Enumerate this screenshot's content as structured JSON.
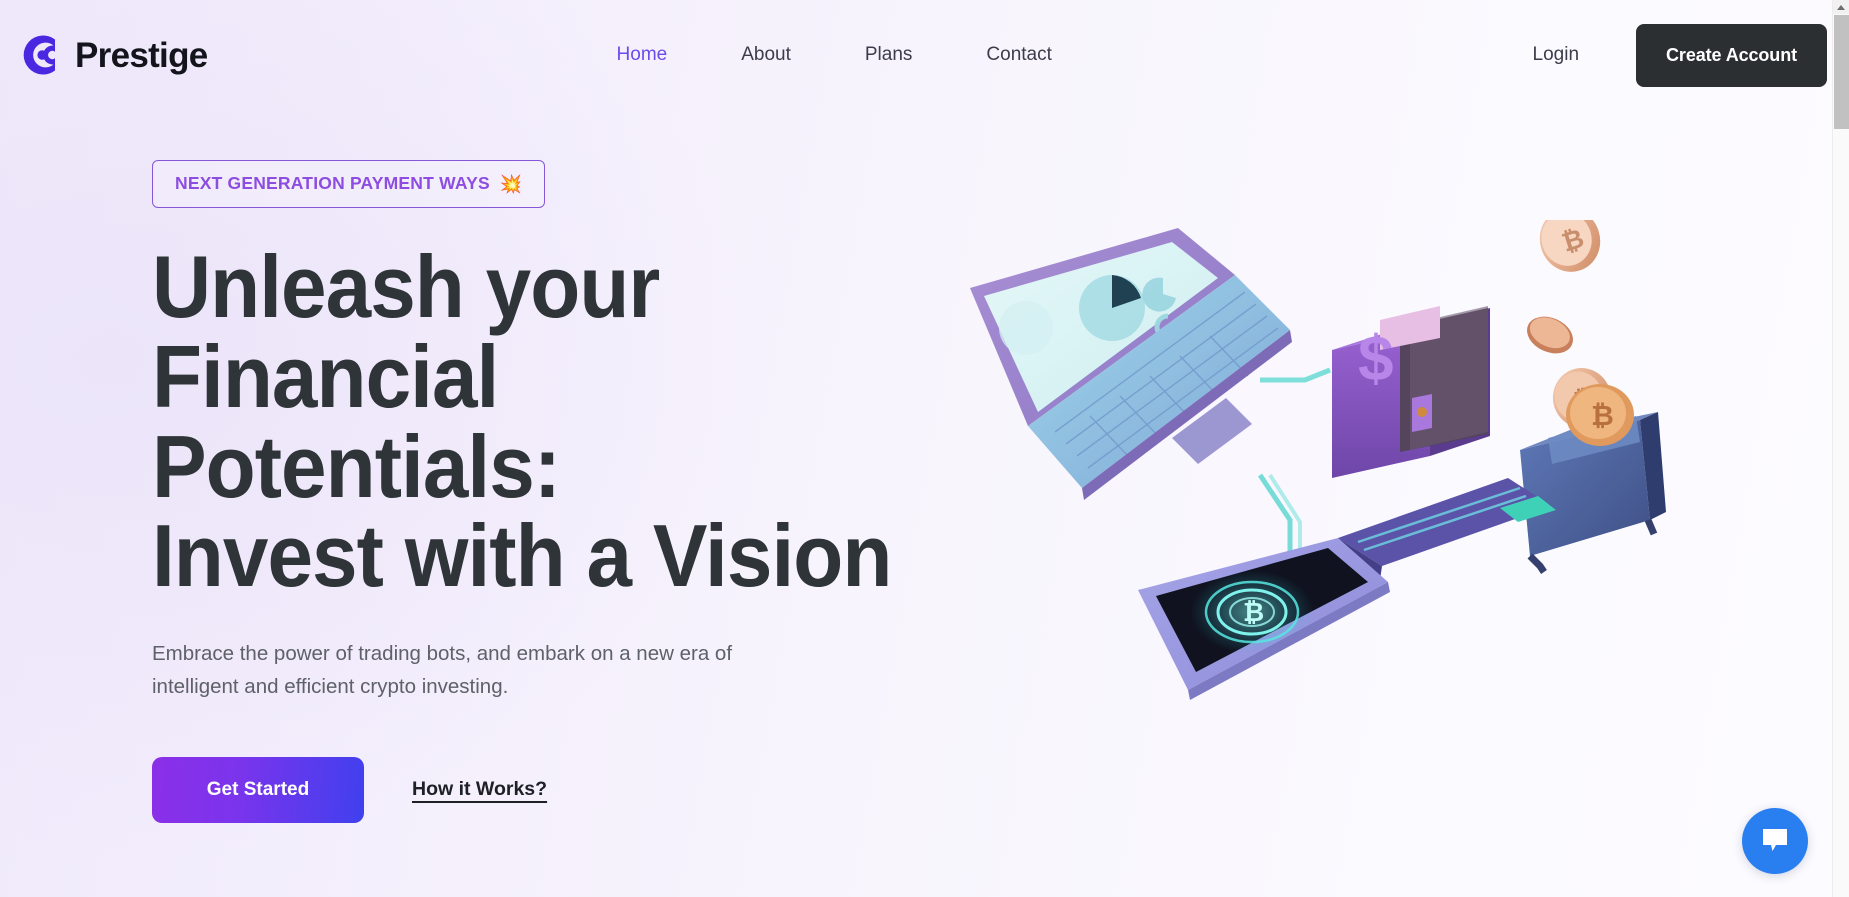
{
  "brand": {
    "name": "Prestige",
    "logo_icon": "prestige-circle-logo",
    "logo_color": "#4a27e0"
  },
  "nav": {
    "items": [
      {
        "label": "Home",
        "active": true
      },
      {
        "label": "About",
        "active": false
      },
      {
        "label": "Plans",
        "active": false
      },
      {
        "label": "Contact",
        "active": false
      }
    ],
    "login_label": "Login",
    "create_account_label": "Create Account",
    "create_account_bg": "#2b2f31",
    "active_color": "#6d4aec"
  },
  "hero": {
    "badge_text": "NEXT GENERATION PAYMENT WAYS",
    "badge_emoji": "💥",
    "badge_border_color": "#8658d8",
    "badge_text_color": "#8c4de0",
    "headline": "Unleash your\nFinancial\nPotentials:\nInvest with a Vision",
    "subhead": "Embrace the power of trading bots, and embark on a new era of\nintelligent and efficient crypto investing.",
    "primary_cta_label": "Get Started",
    "primary_cta_gradient_from": "#8b2fe8",
    "primary_cta_gradient_to": "#4040ee",
    "secondary_cta_label": "How it Works?",
    "illustration_name": "crypto-payment-3d-illustration",
    "illustration_elements": [
      "laptop-with-charts",
      "purple-wallet-with-dollar-sign",
      "smartphone-with-bitcoin-glow",
      "cash-register-with-bitcoin-coin",
      "floating-bitcoin-coins"
    ]
  },
  "chat": {
    "icon": "chat-bubble-icon",
    "color": "#2a7ff0"
  },
  "scrollbar": {
    "thumb_color": "#c1c1c1",
    "track_color": "#fafafa"
  }
}
